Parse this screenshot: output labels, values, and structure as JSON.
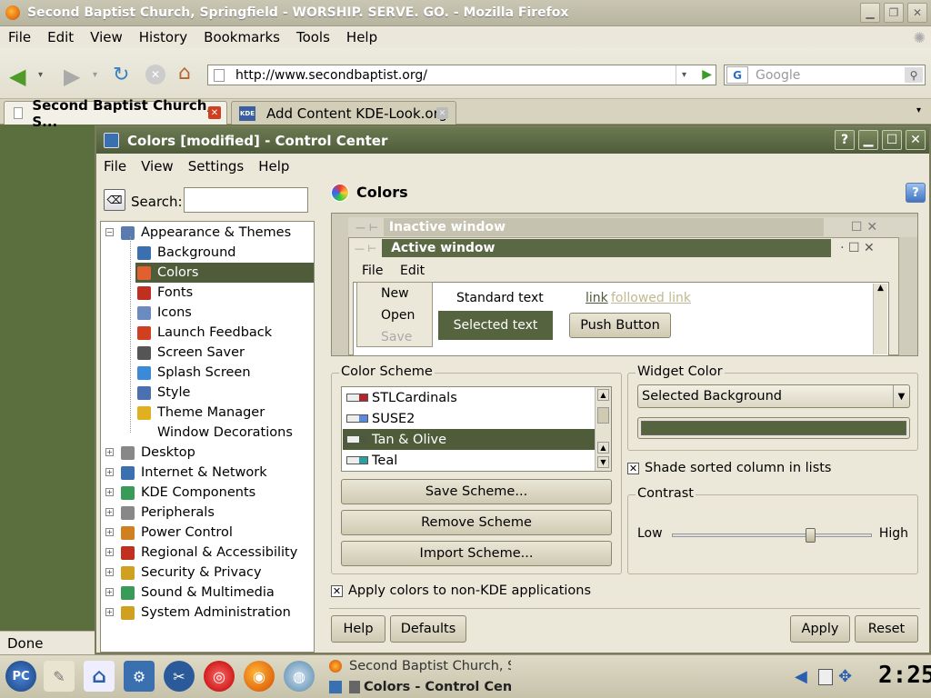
{
  "firefox": {
    "window_title": "Second Baptist Church, Springfield - WORSHIP. SERVE. GO. - Mozilla Firefox",
    "menu": [
      "File",
      "Edit",
      "View",
      "History",
      "Bookmarks",
      "Tools",
      "Help"
    ],
    "url": "http://www.secondbaptist.org/",
    "search_placeholder": "Google",
    "search_engine": "G",
    "tabs": [
      {
        "label": "Second Baptist Church, S...",
        "active": true
      },
      {
        "label": "Add Content KDE-Look.org",
        "active": false
      }
    ],
    "kde_logo_text": "KDE",
    "status": "Done"
  },
  "dialog": {
    "title": "Colors [modified] - Control Center",
    "menu": [
      "File",
      "View",
      "Settings",
      "Help"
    ],
    "search_label": "Search:",
    "search_value": "",
    "tree": [
      {
        "label": "Appearance & Themes",
        "level": 0,
        "expanded": true,
        "icon": "appearance-icon"
      },
      {
        "label": "Background",
        "level": 1,
        "icon": "background-icon"
      },
      {
        "label": "Colors",
        "level": 1,
        "selected": true,
        "icon": "colors-icon"
      },
      {
        "label": "Fonts",
        "level": 1,
        "icon": "fonts-icon"
      },
      {
        "label": "Icons",
        "level": 1,
        "icon": "icons-icon"
      },
      {
        "label": "Launch Feedback",
        "level": 1,
        "icon": "rocket-icon"
      },
      {
        "label": "Screen Saver",
        "level": 1,
        "icon": "screensaver-icon"
      },
      {
        "label": "Splash Screen",
        "level": 1,
        "icon": "splash-icon"
      },
      {
        "label": "Style",
        "level": 1,
        "icon": "style-icon"
      },
      {
        "label": "Theme Manager",
        "level": 1,
        "icon": "theme-icon"
      },
      {
        "label": "Window Decorations",
        "level": 1,
        "icon": ""
      },
      {
        "label": "Desktop",
        "level": 0,
        "icon": "desktop-icon"
      },
      {
        "label": "Internet & Network",
        "level": 0,
        "icon": "globe-icon"
      },
      {
        "label": "KDE Components",
        "level": 0,
        "icon": "components-icon"
      },
      {
        "label": "Peripherals",
        "level": 0,
        "icon": "mouse-icon"
      },
      {
        "label": "Power Control",
        "level": 0,
        "icon": "power-icon"
      },
      {
        "label": "Regional & Accessibility",
        "level": 0,
        "icon": "flag-icon"
      },
      {
        "label": "Security & Privacy",
        "level": 0,
        "icon": "lock-icon"
      },
      {
        "label": "Sound & Multimedia",
        "level": 0,
        "icon": "sound-icon"
      },
      {
        "label": "System Administration",
        "level": 0,
        "icon": "admin-icon"
      }
    ],
    "panel_title": "Colors",
    "preview": {
      "inactive_title": "Inactive window",
      "active_title": "Active window",
      "menu": [
        "File",
        "Edit"
      ],
      "popup": [
        "New",
        "Open",
        "Save"
      ],
      "standard_text": "Standard text",
      "selected_text": "Selected text",
      "link": "link",
      "followed_link": "followed link",
      "push_button": "Push Button"
    },
    "color_scheme": {
      "label": "Color Scheme",
      "items": [
        {
          "name": "STLCardinals",
          "swatch": "#b3252e"
        },
        {
          "name": "SUSE2",
          "swatch": "#5b8ad8"
        },
        {
          "name": "Tan & Olive",
          "swatch": "#4a5a3a",
          "selected": true
        },
        {
          "name": "Teal",
          "swatch": "#2f9e9e"
        }
      ],
      "save": "Save Scheme...",
      "remove": "Remove Scheme",
      "import": "Import Scheme..."
    },
    "widget_color": {
      "label": "Widget Color",
      "selected": "Selected Background",
      "swatch": "#55633e"
    },
    "shade_sorted": "Shade sorted column in lists",
    "contrast": {
      "label": "Contrast",
      "low": "Low",
      "high": "High",
      "value": 0.7
    },
    "apply_non_kde": "Apply colors to non-KDE applications",
    "buttons": {
      "help": "Help",
      "defaults": "Defaults",
      "apply": "Apply",
      "reset": "Reset"
    }
  },
  "taskbar": {
    "start": "PC",
    "tasks": [
      "Second Baptist Church, Sp",
      "Colors - Control Cente"
    ],
    "clock": "2:25"
  },
  "colors": {
    "olive_selected": "#4f5c3a",
    "tan_bg": "#ebe8d9"
  }
}
